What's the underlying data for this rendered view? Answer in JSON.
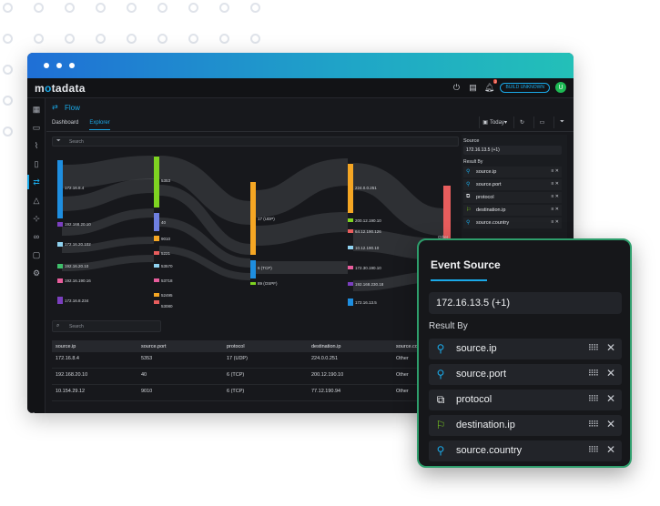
{
  "app": {
    "logo_pre": "m",
    "logo_o": "o",
    "logo_post": "tadata",
    "unknown_badge": "BUILD UNKNOWN",
    "avatar_initial": "U",
    "notif_count": "2"
  },
  "page": {
    "title": "Flow",
    "tabs": [
      "Dashboard",
      "Explorer"
    ],
    "time_filter": "Today"
  },
  "search": {
    "placeholder": "Search"
  },
  "sankey": {
    "col1": [
      "172.16.8.4",
      "192.168.20.10",
      "172.16.20.102",
      "192.16.20.10",
      "192.16.190.16",
      "172.16.8.234"
    ],
    "col2": [
      "5353",
      "40",
      "9010",
      "5221",
      "53570",
      "53718",
      "52495",
      "53080"
    ],
    "col3": [
      "17 (UDP)",
      "6 (TCP)",
      "89 (OSPF)"
    ],
    "col4": [
      "224.0.0.251",
      "200.12.190.10",
      "64.12.190.126",
      "10.12.190.10",
      "172.30.190.10",
      "192.168.230.18",
      "172.16.13.5"
    ],
    "col5": [
      "Other"
    ]
  },
  "right_panel": {
    "title": "Source",
    "value": "172.16.13.5 (+1)",
    "result_by": "Result By",
    "items": [
      {
        "label": "source.ip",
        "icon": "pin-icon"
      },
      {
        "label": "source.port",
        "icon": "pin-icon"
      },
      {
        "label": "protocol",
        "icon": "protocol-icon"
      },
      {
        "label": "destination.ip",
        "icon": "flag-icon"
      },
      {
        "label": "source.country",
        "icon": "pin-icon"
      }
    ]
  },
  "table": {
    "search_placeholder": "Search",
    "columns": [
      "source.ip",
      "source.port",
      "protocol",
      "destination.ip",
      "source.co"
    ],
    "rows": [
      [
        "172.16.8.4",
        "5353",
        "17 (UDP)",
        "224.0.0.251",
        "Other"
      ],
      [
        "192.168.20.10",
        "40",
        "6 (TCP)",
        "200.12.190.10",
        "Other"
      ],
      [
        "10.154.29.12",
        "9010",
        "6 (TCP)",
        "77.12.190.94",
        "Other"
      ]
    ]
  },
  "card": {
    "title": "Event Source",
    "value": "172.16.13.5 (+1)",
    "result_by": "Result By",
    "items": [
      {
        "label": "source.ip",
        "icon": "pin-icon"
      },
      {
        "label": "source.port",
        "icon": "pin-icon"
      },
      {
        "label": "protocol",
        "icon": "protocol-icon"
      },
      {
        "label": "destination.ip",
        "icon": "flag-icon"
      },
      {
        "label": "source.country",
        "icon": "pin-icon"
      }
    ]
  },
  "colors": {
    "accent": "#1aa9e8",
    "card_border": "#2e9e6c",
    "flag": "#7ed321"
  }
}
